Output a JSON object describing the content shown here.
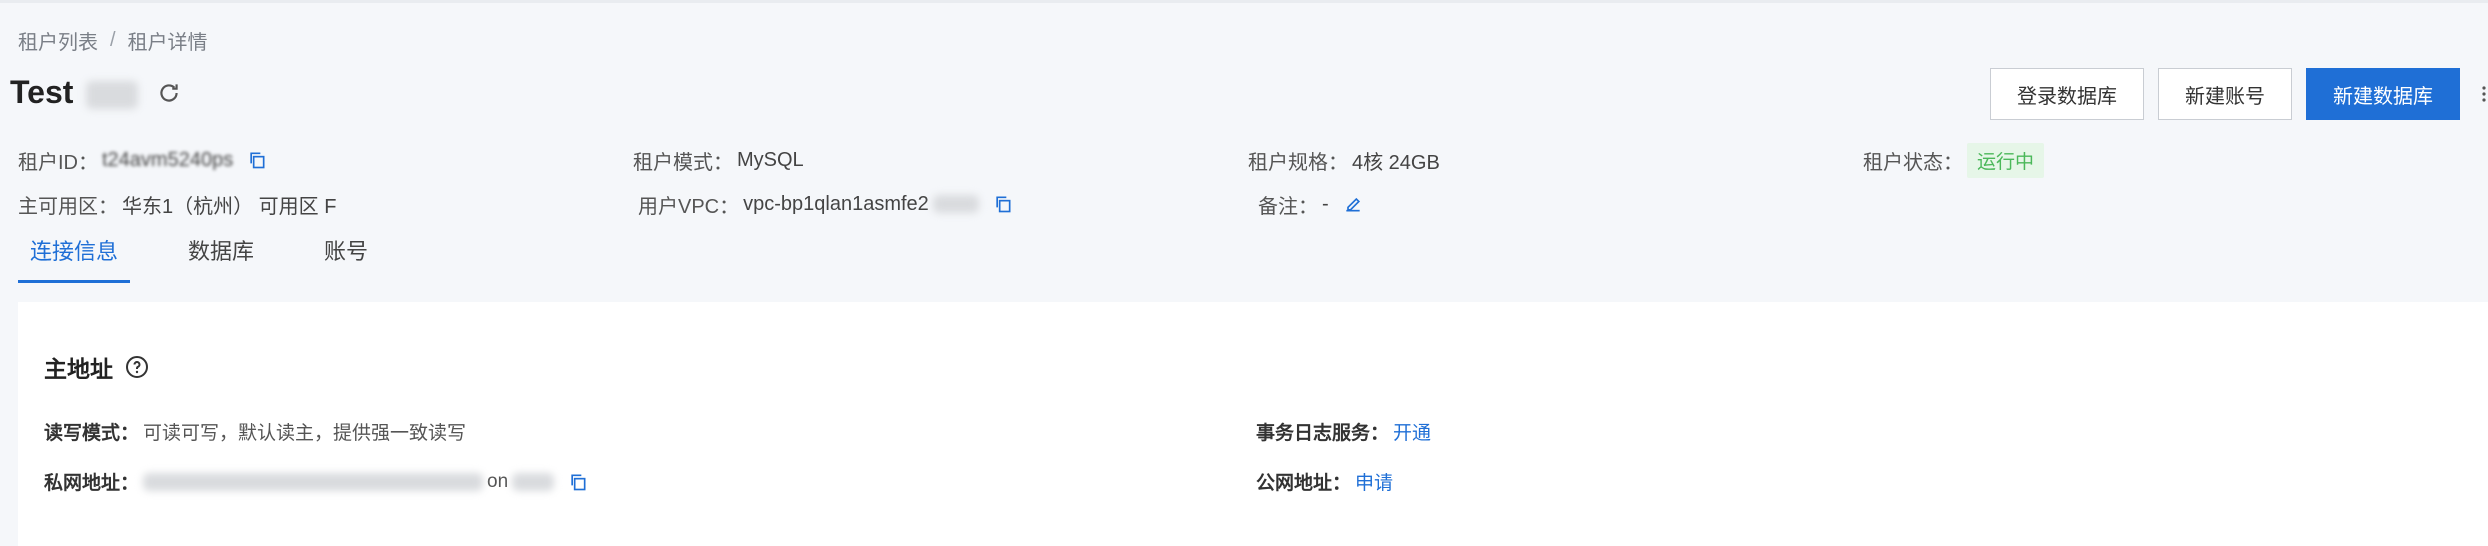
{
  "breadcrumb": {
    "items": [
      "租户列表",
      "租户详情"
    ],
    "separator": "/"
  },
  "page": {
    "title": "Test"
  },
  "actions": {
    "login_db": "登录数据库",
    "new_account": "新建账号",
    "new_db": "新建数据库"
  },
  "info": {
    "tenant_id_label": "租户ID：",
    "tenant_id_value": "t24avm5240ps",
    "tenant_mode_label": "租户模式：",
    "tenant_mode_value": "MySQL",
    "tenant_spec_label": "租户规格：",
    "tenant_spec_value": "4核 24GB",
    "tenant_status_label": "租户状态：",
    "tenant_status_value": "运行中",
    "zone_label": "主可用区：",
    "zone_value": "华东1（杭州） 可用区 F",
    "vpc_label": "用户VPC：",
    "vpc_value": "vpc-bp1qlan1asmfe2",
    "remark_label": "备注：",
    "remark_value": "-"
  },
  "tabs": [
    "连接信息",
    "数据库",
    "账号"
  ],
  "panel": {
    "title": "主地址",
    "rw_mode_label": "读写模式：",
    "rw_mode_value": "可读可写，默认读主，提供强一致读写",
    "txlog_label": "事务日志服务：",
    "txlog_link": "开通",
    "private_addr_label": "私网地址：",
    "private_addr_value": "on",
    "public_addr_label": "公网地址：",
    "public_addr_link": "申请"
  },
  "colors": {
    "primary": "#1f6fd6",
    "status_green": "#4bb85a"
  }
}
